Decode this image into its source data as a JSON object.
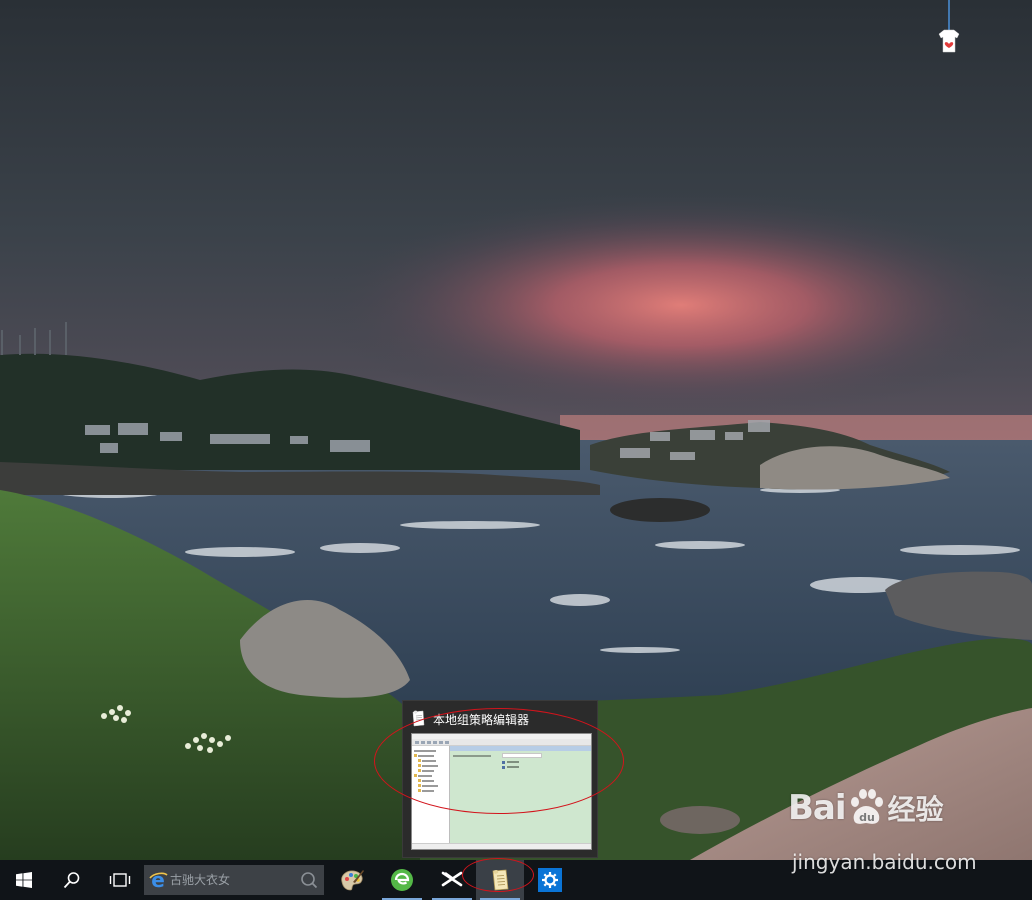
{
  "desktop": {
    "wallpaper": "coastal village under storm clouds at sunset"
  },
  "search": {
    "placeholder": "古驰大衣女"
  },
  "taskbar": {
    "start": "windows-start-icon",
    "search_button": "search-icon",
    "task_view": "task-view-icon",
    "pinned_apps": [
      {
        "name": "paint-palette-icon"
      },
      {
        "name": "green-browser-icon"
      },
      {
        "name": "capcut-icon"
      },
      {
        "name": "group-policy-editor-icon"
      },
      {
        "name": "settings-gear-icon"
      }
    ]
  },
  "preview": {
    "title": "本地组策略编辑器"
  },
  "watermark": {
    "brand": "Bai",
    "brand_suffix": "经验",
    "url": "jingyan.baidu.com"
  },
  "colors": {
    "taskbar_bg": "#101418",
    "annotation": "#d2141c",
    "active_indicator": "#7aa7d9"
  }
}
